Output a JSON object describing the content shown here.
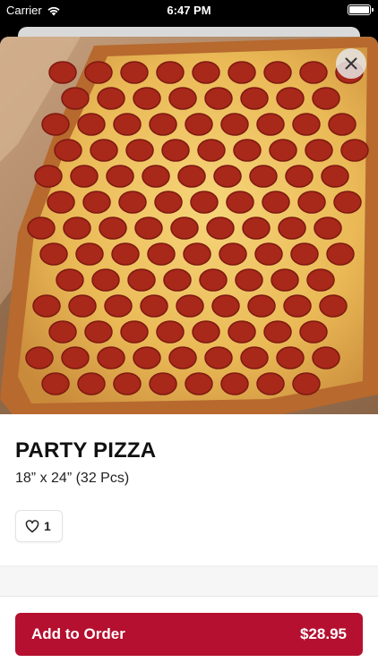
{
  "status_bar": {
    "carrier": "Carrier",
    "time": "6:47 PM"
  },
  "item": {
    "name": "PARTY PIZZA",
    "size": "18” x 24” (32 Pcs)",
    "favorite_count": "1",
    "image_icon": "pizza-photo"
  },
  "footer": {
    "add_label": "Add to Order",
    "price": "$28.95"
  },
  "colors": {
    "accent": "#b5102f",
    "background": "#ffffff",
    "band": "#f6f6f6"
  }
}
